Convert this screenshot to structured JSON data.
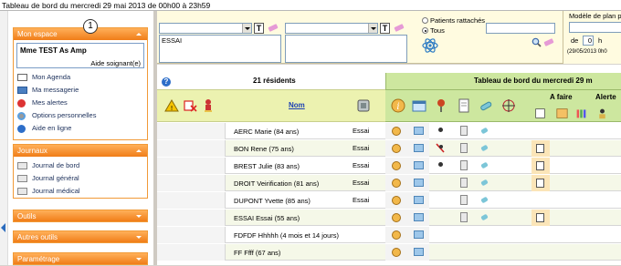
{
  "window": {
    "title": "Tableau de bord du mercredi 29 mai 2013 de 00h00 à 23h59"
  },
  "sidebar": {
    "mon_espace": {
      "header": "Mon espace",
      "user_name": "Mme TEST As Amp",
      "user_role": "Aide soignant(e)",
      "badge": "1",
      "items": [
        {
          "label": "Mon Agenda",
          "icon": "calendar-icon"
        },
        {
          "label": "Ma messagerie",
          "icon": "mail-icon"
        },
        {
          "label": "Mes alertes",
          "icon": "alert-icon"
        },
        {
          "label": "Options personnelles",
          "icon": "options-icon"
        },
        {
          "label": "Aide en ligne",
          "icon": "help-icon"
        }
      ]
    },
    "journaux": {
      "header": "Journaux",
      "items": [
        {
          "label": "Journal de bord"
        },
        {
          "label": "Journal général"
        },
        {
          "label": "Journal médical"
        }
      ]
    },
    "outils": "Outils",
    "autres_outils": "Autres outils",
    "parametrage": "Paramétrage"
  },
  "filter": {
    "free_text": "ESSAI",
    "radio_attached": "Patients rattachés",
    "radio_all": "Tous",
    "selected_radio": "Tous",
    "tbtn_label": "T",
    "model_label": "Modèle de plan po",
    "de_label": "de",
    "hour_value": "0",
    "h_label": "h",
    "date_small": "(29/05/2013 0h0"
  },
  "grid": {
    "residents_count": "21 résidents",
    "dashboard_title": "Tableau de bord du mercredi 29 m",
    "col_name": "Nom",
    "a_faire": "A faire",
    "alerte": "Alerte",
    "rows": [
      {
        "name": "AERC Marie (84 ans)",
        "etab": "Essai",
        "pin": "dot",
        "doc": true,
        "pill": true,
        "todo": false
      },
      {
        "name": "BON Rene (75 ans)",
        "etab": "Essai",
        "pin": "cross",
        "doc": true,
        "pill": true,
        "todo": true
      },
      {
        "name": "BREST Julie (83 ans)",
        "etab": "Essai",
        "pin": "dot",
        "doc": true,
        "pill": true,
        "todo": true
      },
      {
        "name": "DROIT Veirification (81 ans)",
        "etab": "Essai",
        "pin": "",
        "doc": true,
        "pill": true,
        "todo": true
      },
      {
        "name": "DUPONT Yvette (85 ans)",
        "etab": "Essai",
        "pin": "",
        "doc": true,
        "pill": true,
        "todo": false
      },
      {
        "name": "ESSAI Essai (55 ans)",
        "etab": "",
        "pin": "",
        "doc": true,
        "pill": true,
        "todo": true
      },
      {
        "name": "FDFDF Hhhhh (4 mois et 14 jours)",
        "etab": "",
        "pin": "",
        "doc": false,
        "pill": false,
        "todo": false
      },
      {
        "name": "FF Ffff (67 ans)",
        "etab": "",
        "pin": "",
        "doc": false,
        "pill": false,
        "todo": false
      }
    ]
  },
  "colors": {
    "accent_orange": "#f07d18",
    "header_green": "#cde79f",
    "filter_yellow": "#fffbe0"
  }
}
